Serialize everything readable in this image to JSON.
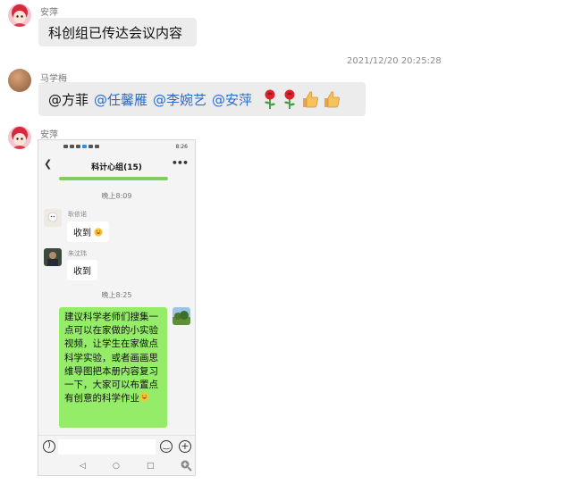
{
  "messages": [
    {
      "sender": "安萍",
      "text": "科创组已传达会议内容"
    },
    {
      "sender": "马学梅",
      "mentions": [
        "@方菲",
        "@任馨雁",
        "@李婉艺",
        "@安萍"
      ],
      "emoji_icons": [
        "rose-icon",
        "rose-icon",
        "thumbs-up-icon",
        "thumbs-up-icon"
      ]
    },
    {
      "sender": "安萍",
      "image": "phone-screenshot"
    }
  ],
  "timestamp": "2021/12/20 20:25:28",
  "phone": {
    "status_time": "8:26",
    "header": {
      "title": "科计心组(15)",
      "back_icon": "chevron-left-icon",
      "more_icon": "more-dots-icon"
    },
    "time1": "晚上8:09",
    "time2": "晚上8:25",
    "messages": [
      {
        "name": "耿依诺",
        "text": "收到",
        "emoji": "smile-emoji-icon"
      },
      {
        "name": "朱沈玮",
        "text": "收到"
      }
    ],
    "self_message": "建议科学老师们搜集一点可以在家做的小实验视频，让学生在家做点科学实验，或者画画思维导图把本册内容复习一下，大家可以布置点有创意的科学作业",
    "input_icons": [
      "voice-icon",
      "emoji-icon",
      "plus-icon"
    ],
    "nav_icons": [
      "back-triangle-icon",
      "home-circle-icon",
      "recent-square-icon"
    ],
    "zoom_icon": "zoom-in-icon"
  },
  "colors": {
    "mention": "#2b6cc4",
    "bubble": "#ececec",
    "green_bubble": "#95ec69"
  }
}
